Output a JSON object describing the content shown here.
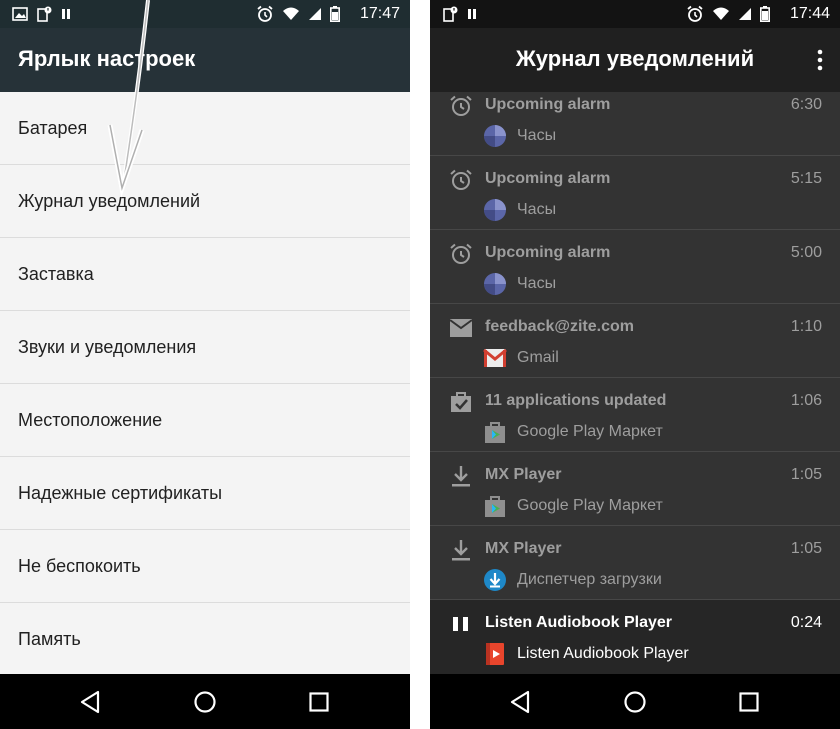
{
  "left_screen": {
    "status_time": "17:47",
    "title": "Ярлык настроек",
    "items": [
      {
        "label": "Батарея"
      },
      {
        "label": "Журнал уведомлений"
      },
      {
        "label": "Заставка"
      },
      {
        "label": "Звуки и уведомления"
      },
      {
        "label": "Местоположение"
      },
      {
        "label": "Надежные сертификаты"
      },
      {
        "label": "Не беспокоить"
      },
      {
        "label": "Память"
      }
    ]
  },
  "right_screen": {
    "status_time": "17:44",
    "title": "Журнал уведомлений",
    "entries": [
      {
        "icon": "alarm-icon",
        "title": "Upcoming alarm",
        "time": "6:30",
        "app_icon": "clock-app-icon",
        "app": "Часы"
      },
      {
        "icon": "alarm-icon",
        "title": "Upcoming alarm",
        "time": "5:15",
        "app_icon": "clock-app-icon",
        "app": "Часы"
      },
      {
        "icon": "alarm-icon",
        "title": "Upcoming alarm",
        "time": "5:00",
        "app_icon": "clock-app-icon",
        "app": "Часы"
      },
      {
        "icon": "mail-icon",
        "title": "feedback@zite.com",
        "time": "1:10",
        "app_icon": "gmail-app-icon",
        "app": "Gmail"
      },
      {
        "icon": "update-icon",
        "title": "11 applications updated",
        "time": "1:06",
        "app_icon": "play-store-app-icon",
        "app": "Google Play Маркет"
      },
      {
        "icon": "download-icon",
        "title": "MX Player",
        "time": "1:05",
        "app_icon": "play-store-app-icon",
        "app": "Google Play Маркет"
      },
      {
        "icon": "download-icon",
        "title": "MX Player",
        "time": "1:05",
        "app_icon": "download-manager-app-icon",
        "app": "Диспетчер загрузки"
      },
      {
        "icon": "pause-icon",
        "title": "Listen Audiobook Player",
        "time": "0:24",
        "app_icon": "audiobook-app-icon",
        "app": "Listen Audiobook Player"
      }
    ]
  },
  "colors": {
    "left_appbar": "#263238",
    "right_background": "#333333",
    "navbar": "#000000"
  }
}
